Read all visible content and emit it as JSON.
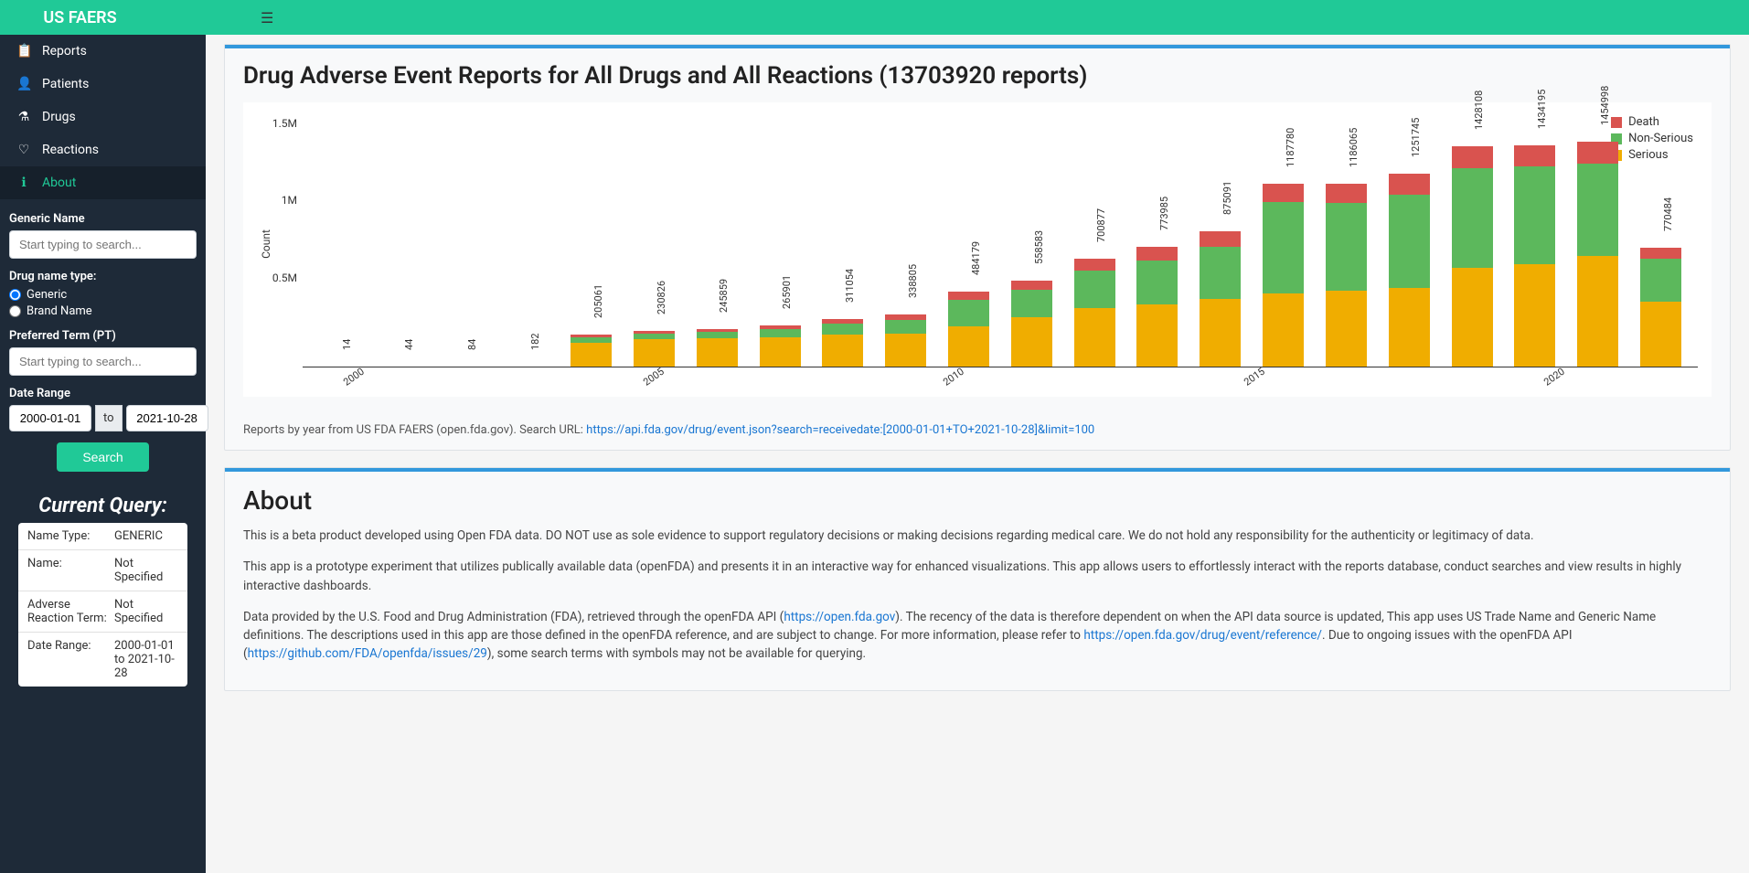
{
  "brand": "US FAERS",
  "nav": [
    {
      "label": "Reports",
      "icon": "reports"
    },
    {
      "label": "Patients",
      "icon": "patients"
    },
    {
      "label": "Drugs",
      "icon": "drugs"
    },
    {
      "label": "Reactions",
      "icon": "reactions"
    },
    {
      "label": "About",
      "icon": "about"
    }
  ],
  "sidebar": {
    "generic_name_label": "Generic Name",
    "generic_name_placeholder": "Start typing to search...",
    "drug_name_type_label": "Drug name type:",
    "radio_generic": "Generic",
    "radio_brand": "Brand Name",
    "preferred_term_label": "Preferred Term (PT)",
    "preferred_term_placeholder": "Start typing to search...",
    "date_range_label": "Date Range",
    "date_from": "2000-01-01",
    "date_to_sep": "to",
    "date_to": "2021-10-28",
    "search_btn": "Search",
    "current_query_heading": "Current Query:",
    "query": [
      {
        "k": "Name Type:",
        "v": "GENERIC"
      },
      {
        "k": "Name:",
        "v": "Not Specified"
      },
      {
        "k": "Adverse Reaction Term:",
        "v": "Not Specified"
      },
      {
        "k": "Date Range:",
        "v": "2000-01-01 to 2021-10-28"
      }
    ]
  },
  "card_title": "Drug Adverse Event Reports for All Drugs and All Reactions (13703920 reports)",
  "caption_prefix": "Reports by year from US FDA FAERS (open.fda.gov). Search URL: ",
  "caption_link": "https://api.fda.gov/drug/event.json?search=receivedate:[2000-01-01+TO+2021-10-28]&limit=100",
  "about": {
    "heading": "About",
    "p1": "This is a beta product developed using Open FDA data. DO NOT use as sole evidence to support regulatory decisions or making decisions regarding medical care. We do not hold any responsibility for the authenticity or legitimacy of data.",
    "p2": "This app is a prototype experiment that utilizes publically available data (openFDA) and presents it in an interactive way for enhanced visualizations. This app allows users to effortlessly interact with the reports database, conduct searches and view results in highly interactive dashboards.",
    "p3a": "Data provided by the U.S. Food and Drug Administration (FDA), retrieved through the openFDA API (",
    "p3link1": "https://open.fda.gov",
    "p3b": "). The recency of the data is therefore dependent on when the API data source is updated, This app uses US Trade Name and Generic Name definitions. The descriptions used in this app are those defined in the openFDA reference, and are subject to change. For more information, please refer to ",
    "p3link2": "https://open.fda.gov/drug/event/reference/",
    "p3c": ". Due to ongoing issues with the openFDA API (",
    "p3link3": "https://github.com/FDA/openfda/issues/29",
    "p3d": "), some search terms with symbols may not be available for querying."
  },
  "chart_data": {
    "type": "bar",
    "ylabel": "Count",
    "ylim": [
      0,
      1600000
    ],
    "yticks": [
      {
        "v": 500000,
        "label": "0.5M"
      },
      {
        "v": 1000000,
        "label": "1M"
      },
      {
        "v": 1500000,
        "label": "1.5M"
      }
    ],
    "xticks": [
      "2000",
      "2005",
      "2010",
      "2015",
      "2020"
    ],
    "legend": [
      "Death",
      "Non-Serious",
      "Serious"
    ],
    "colors": {
      "Death": "#d9534f",
      "Non-Serious": "#5cb85c",
      "Serious": "#f0ad00"
    },
    "categories": [
      "2000",
      "2001",
      "2002",
      "2003",
      "2004",
      "2005",
      "2006",
      "2007",
      "2008",
      "2009",
      "2010",
      "2011",
      "2012",
      "2013",
      "2014",
      "2015",
      "2016",
      "2017",
      "2018",
      "2019",
      "2020",
      "2021"
    ],
    "totals": [
      14,
      44,
      84,
      182,
      205061,
      230826,
      245859,
      265901,
      311054,
      338805,
      484179,
      558583,
      700877,
      773985,
      875091,
      1187780,
      1186065,
      1251745,
      1428108,
      1434195,
      1454998,
      770484
    ],
    "series": [
      {
        "name": "Serious",
        "values": [
          10,
          30,
          60,
          130,
          155000,
          175000,
          185000,
          190000,
          205000,
          215000,
          260000,
          320000,
          380000,
          405000,
          440000,
          475000,
          490000,
          510000,
          640000,
          665000,
          720000,
          420000
        ]
      },
      {
        "name": "Non-Serious",
        "values": [
          3,
          10,
          18,
          40,
          35000,
          38000,
          41000,
          52000,
          75000,
          90000,
          170000,
          175000,
          240000,
          280000,
          335000,
          590000,
          570000,
          605000,
          645000,
          630000,
          595000,
          280000
        ]
      },
      {
        "name": "Death",
        "values": [
          1,
          4,
          6,
          12,
          15061,
          17826,
          19859,
          23901,
          31054,
          33805,
          54179,
          63583,
          80877,
          88985,
          100091,
          122780,
          126065,
          136745,
          143108,
          139195,
          139998,
          70484
        ]
      }
    ]
  }
}
